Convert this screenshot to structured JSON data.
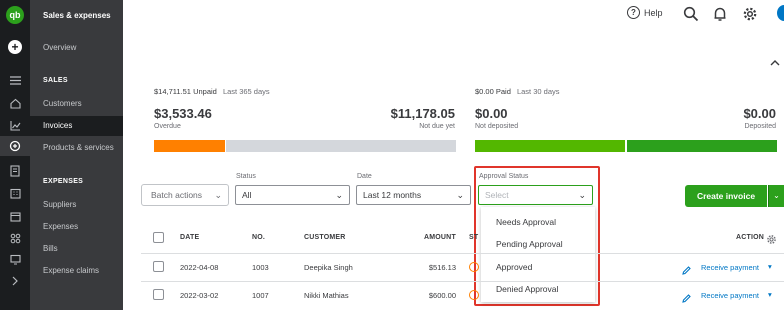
{
  "app": {
    "logo": "qb",
    "section_title": "Sales & expenses"
  },
  "colors": {
    "brand_green": "#2ca01c",
    "overdue_orange": "#ff8000",
    "highlight_red": "#e0352b",
    "link_blue": "#0077c5"
  },
  "rail_icons": [
    "plus-icon",
    "menu-icon",
    "home-icon",
    "chart-icon",
    "sales-icon",
    "document-icon",
    "building-icon",
    "calendar-icon",
    "apps-icon",
    "monitor-icon",
    "chevron-right-icon"
  ],
  "nav": {
    "overview": "Overview",
    "sales_header": "SALES",
    "sales_items": [
      "Customers",
      "Invoices",
      "Products & services"
    ],
    "expenses_header": "EXPENSES",
    "expense_items": [
      "Suppliers",
      "Expenses",
      "Bills",
      "Expense claims"
    ]
  },
  "topbar": {
    "help_label": "Help",
    "icons": [
      "search-icon",
      "bell-icon",
      "gear-icon"
    ]
  },
  "summary": {
    "unpaid": {
      "amount": "$14,711.51 Unpaid",
      "period": "Last 365 days"
    },
    "overdue": {
      "value": "$3,533.46",
      "label": "Overdue"
    },
    "not_due": {
      "value": "$11,178.05",
      "label": "Not due yet"
    },
    "paid": {
      "amount": "$0.00 Paid",
      "period": "Last 30 days"
    },
    "not_deposited": {
      "value": "$0.00",
      "label": "Not deposited"
    },
    "deposited": {
      "value": "$0.00",
      "label": "Deposited"
    }
  },
  "filters": {
    "batch_actions": "Batch actions",
    "status_label": "Status",
    "status_value": "All",
    "date_label": "Date",
    "date_value": "Last 12 months",
    "approval_label": "Approval Status",
    "approval_placeholder": "Select",
    "approval_options": [
      "Needs Approval",
      "Pending Approval",
      "Approved",
      "Denied Approval"
    ]
  },
  "create_invoice": "Create invoice",
  "table": {
    "headers": {
      "date": "DATE",
      "no": "NO.",
      "customer": "CUSTOMER",
      "amount": "AMOUNT",
      "status": "ST",
      "action": "ACTION"
    },
    "rows": [
      {
        "date": "2022-04-08",
        "no": "1003",
        "customer": "Deepika Singh",
        "amount": "$516.13",
        "action": "Receive payment"
      },
      {
        "date": "2022-03-02",
        "no": "1007",
        "customer": "Nikki Mathias",
        "amount": "$600.00",
        "action": "Receive payment"
      }
    ]
  }
}
